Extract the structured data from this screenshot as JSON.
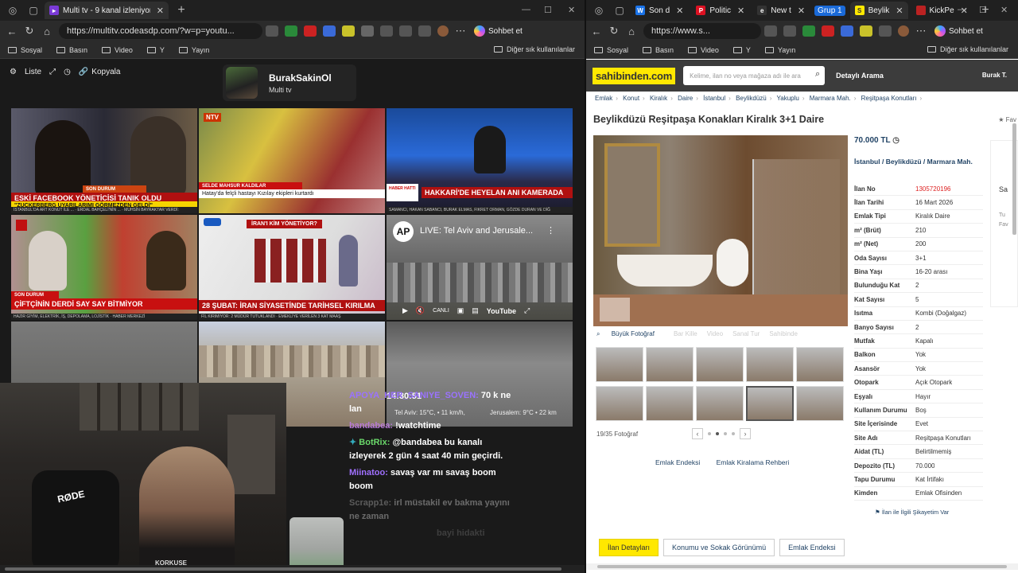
{
  "left_window": {
    "tab": {
      "title": "Multi tv - 9 kanal izleniyor"
    },
    "url": "https://multitv.codeasdp.com/?w=p=youtu...",
    "copilot_label": "Sohbet et",
    "bookmarks": [
      "Sosyal",
      "Basın",
      "Video",
      "Y",
      "Yayın"
    ],
    "bookmarks_other": "Diğer sık kullanılanlar",
    "toolbar": {
      "list_label": "Liste",
      "copy_label": "Kopyala"
    },
    "profile": {
      "name": "BurakSakinOl",
      "subtitle": "Multi tv"
    },
    "tiles": [
      {
        "headline": "ESKİ FACEBOOK YÖNETİCİSİ TANIK OLDU",
        "sub": "\"ZUCKERBERG UYARILARIMI GÖRMEZDEN GELDİ\"",
        "tag": "SON DURUM",
        "ticker": "İSTANBUL'DA ART KONUT İLE ... · ERDAL BAHÇELİ'NİN ... · MUHSİN BAYRAKTAR VERDİ:"
      },
      {
        "headline": "SELDE MAHSUR KALDILAR",
        "sub": "Hatay'da felçli hastayı Kızılay ekipleri kurtardı",
        "logo": "NTV",
        "ticker": ""
      },
      {
        "headline": "HAKKARİ'DE HEYELAN ANI KAMERADA",
        "tag": "HABER HATTI",
        "ticker": "SAMANCI, HAKAN SABANCI, BURAK ELMAS, FIKRET ORMAN, GÖZDE DURAN VE DİĞ"
      },
      {
        "headline": "ÇİFTÇİNİN DERDİ SAY SAY BİTMİYOR",
        "tag": "SON DURUM",
        "ticker": "HAZIR GİYİM, ELEKTRİK, İŞ, DEPOLAMA, LOJİSTİK · HABER MERKEZİ"
      },
      {
        "headline": "28 ŞUBAT: İRAN SİYASETİNDE TARİHSEL KIRILMA",
        "banner": "İRAN'I KİM YÖNETİYOR?",
        "ticker": "FİL KIRIMIYOR: 2 MÜDÜR TUTUKLANDI · EMEKLİYE VERİLEN 3 KAT MAAŞ"
      },
      {
        "live_title": "LIVE: Tel Aviv and Jerusale...",
        "channel": "AP",
        "yt_label": "YouTube",
        "live_label": "CANLI"
      },
      {
        "label": ""
      },
      {
        "label": ""
      },
      {
        "time": "14:30:51",
        "weather_left": "Tel Aviv: 15°C, • 11 km/h,",
        "weather_right": "Jerusalem: 9°C • 22 km"
      }
    ],
    "chat": [
      {
        "user": "APOYA_HER_SANIYE_SOVEN:",
        "text": "70 k ne lan",
        "user_color": "#9a72ff"
      },
      {
        "user": "bandabea:",
        "text": "!watchtime",
        "user_color": "#b77bd6"
      },
      {
        "user": "BotRix:",
        "text": "@bandabea bu kanalı izleyerek 2 gün 4 saat 40 min geçirdi.",
        "user_color": "#6ad86a"
      },
      {
        "user": "Miinatoo:",
        "text": "savaş var mı savaş boom boom",
        "user_color": "#a070ff"
      },
      {
        "user": "Scrapp1e:",
        "text": "irl müstakil ev bakma yayını ne zaman",
        "user_color": "#9a9a9a"
      },
      {
        "user": "",
        "text": "bayi hidakti",
        "user_color": "#555"
      }
    ],
    "cam": {
      "mic_brand": "RØDE",
      "chair_brand": "KORKUSE"
    }
  },
  "right_window": {
    "tabs": [
      {
        "title": "Son d",
        "fav": "#1a73e8",
        "fav_text": "W"
      },
      {
        "title": "Politic",
        "fav": "#d12",
        "fav_text": "P"
      },
      {
        "title": "New t",
        "fav": "#333",
        "fav_text": "e"
      },
      {
        "title": "Grup 1",
        "group": true
      },
      {
        "title": "Beylik",
        "fav": "#ffe800",
        "fav_text": "S",
        "active": true
      },
      {
        "title": "KickPe",
        "fav": "#b22",
        "fav_text": ""
      }
    ],
    "url": "https://www.s...",
    "copilot_label": "Sohbet et",
    "bookmarks": [
      "Sosyal",
      "Basın",
      "Video",
      "Y",
      "Yayın"
    ],
    "bookmarks_other": "Diğer sık kullanılanlar",
    "site": {
      "logo": "sahibinden.com",
      "search_placeholder": "Kelime, ilan no veya mağaza adı ile ara",
      "advanced": "Detaylı Arama",
      "user": "Burak T.",
      "breadcrumbs": [
        "Emlak",
        "Konut",
        "Kiralık",
        "Daire",
        "İstanbul",
        "Beylikdüzü",
        "Yakuplu",
        "Marmara Mah.",
        "Reşitpaşa Konutları"
      ],
      "title": "Beylikdüzü Reşitpaşa Konakları Kiralık 3+1 Daire",
      "fav_label": "Fav",
      "price": "70.000 TL",
      "location": [
        "İstanbul",
        "Beylikdüzü",
        "Marmara Mah."
      ],
      "photo_tabs": [
        "Büyük Fotoğraf",
        "Bar Kille",
        "Video",
        "Sanal Tur",
        "Sahibinde"
      ],
      "photo_count": "19/35 Fotoğraf",
      "links": [
        "Emlak Endeksi",
        "Emlak Kiralama Rehberi"
      ],
      "specs": [
        {
          "k": "İlan No",
          "v": "1305720196",
          "red": true
        },
        {
          "k": "İlan Tarihi",
          "v": "16 Mart 2026"
        },
        {
          "k": "Emlak Tipi",
          "v": "Kiralık Daire"
        },
        {
          "k": "m² (Brüt)",
          "v": "210"
        },
        {
          "k": "m² (Net)",
          "v": "200"
        },
        {
          "k": "Oda Sayısı",
          "v": "3+1"
        },
        {
          "k": "Bina Yaşı",
          "v": "16-20 arası"
        },
        {
          "k": "Bulunduğu Kat",
          "v": "2"
        },
        {
          "k": "Kat Sayısı",
          "v": "5"
        },
        {
          "k": "Isıtma",
          "v": "Kombi (Doğalgaz)"
        },
        {
          "k": "Banyo Sayısı",
          "v": "2"
        },
        {
          "k": "Mutfak",
          "v": "Kapalı"
        },
        {
          "k": "Balkon",
          "v": "Yok"
        },
        {
          "k": "Asansör",
          "v": "Yok"
        },
        {
          "k": "Otopark",
          "v": "Açık Otopark"
        },
        {
          "k": "Eşyalı",
          "v": "Hayır"
        },
        {
          "k": "Kullanım Durumu",
          "v": "Boş"
        },
        {
          "k": "Site İçerisinde",
          "v": "Evet"
        },
        {
          "k": "Site Adı",
          "v": "Reşitpaşa Konutları"
        },
        {
          "k": "Aidat (TL)",
          "v": "Belirtilmemiş"
        },
        {
          "k": "Depozito (TL)",
          "v": "70.000"
        },
        {
          "k": "Tapu Durumu",
          "v": "Kat İrtifakı"
        },
        {
          "k": "Kimden",
          "v": "Emlak Ofisinden"
        }
      ],
      "complaint": "İlan ile İlgili Şikayetim Var",
      "side_labels": [
        "Sa",
        "Tu",
        "Fav"
      ],
      "bottom_tabs": [
        "İlan Detayları",
        "Konumu ve Sokak Görünümü",
        "Emlak Endeksi"
      ]
    }
  }
}
